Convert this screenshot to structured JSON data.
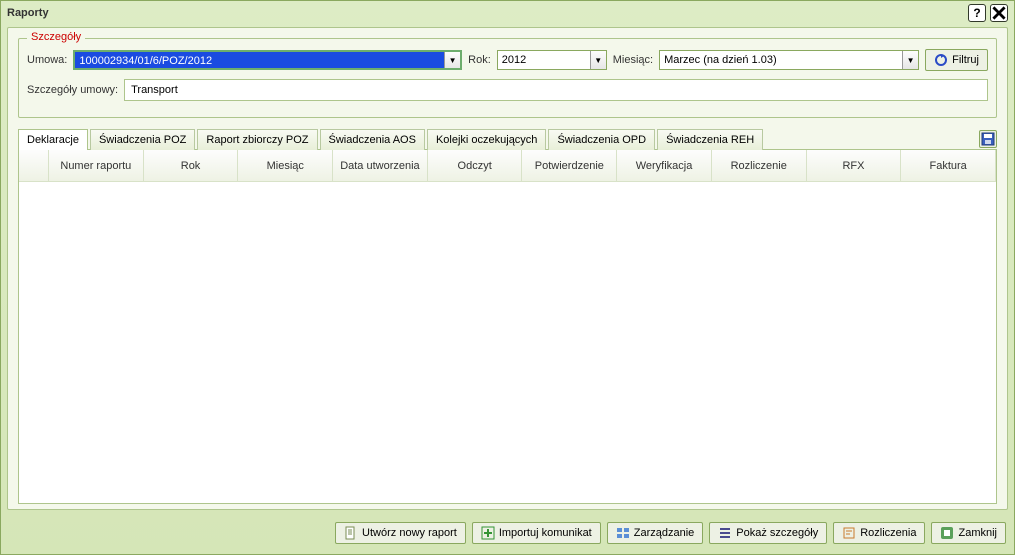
{
  "window": {
    "title": "Raporty"
  },
  "details": {
    "legend": "Szczegóły",
    "contract_label": "Umowa:",
    "contract_value": "100002934/01/6/POZ/2012",
    "year_label": "Rok:",
    "year_value": "2012",
    "month_label": "Miesiąc:",
    "month_value": "Marzec (na dzień 1.03)",
    "filter_btn": "Filtruj",
    "contract_details_label": "Szczegóły umowy:",
    "contract_details_value": "Transport"
  },
  "tabs": [
    {
      "label": "Deklaracje",
      "name": "tab-deklaracje",
      "active": true
    },
    {
      "label": "Świadczenia POZ",
      "name": "tab-swiadczenia-poz",
      "active": false
    },
    {
      "label": "Raport zbiorczy POZ",
      "name": "tab-raport-zbiorczy-poz",
      "active": false
    },
    {
      "label": "Świadczenia AOS",
      "name": "tab-swiadczenia-aos",
      "active": false
    },
    {
      "label": "Kolejki oczekujących",
      "name": "tab-kolejki-oczekujacych",
      "active": false
    },
    {
      "label": "Świadczenia OPD",
      "name": "tab-swiadczenia-opd",
      "active": false
    },
    {
      "label": "Świadczenia REH",
      "name": "tab-swiadczenia-reh",
      "active": false
    }
  ],
  "table": {
    "columns": [
      "",
      "Numer raportu",
      "Rok",
      "Miesiąc",
      "Data utworzenia",
      "Odczyt",
      "Potwierdzenie",
      "Weryfikacja",
      "Rozliczenie",
      "RFX",
      "Faktura"
    ],
    "rows": []
  },
  "actions": {
    "new_report": "Utwórz nowy raport",
    "import_msg": "Importuj komunikat",
    "manage": "Zarządzanie",
    "show_details": "Pokaż szczegóły",
    "settlements": "Rozliczenia",
    "close": "Zamknij"
  }
}
